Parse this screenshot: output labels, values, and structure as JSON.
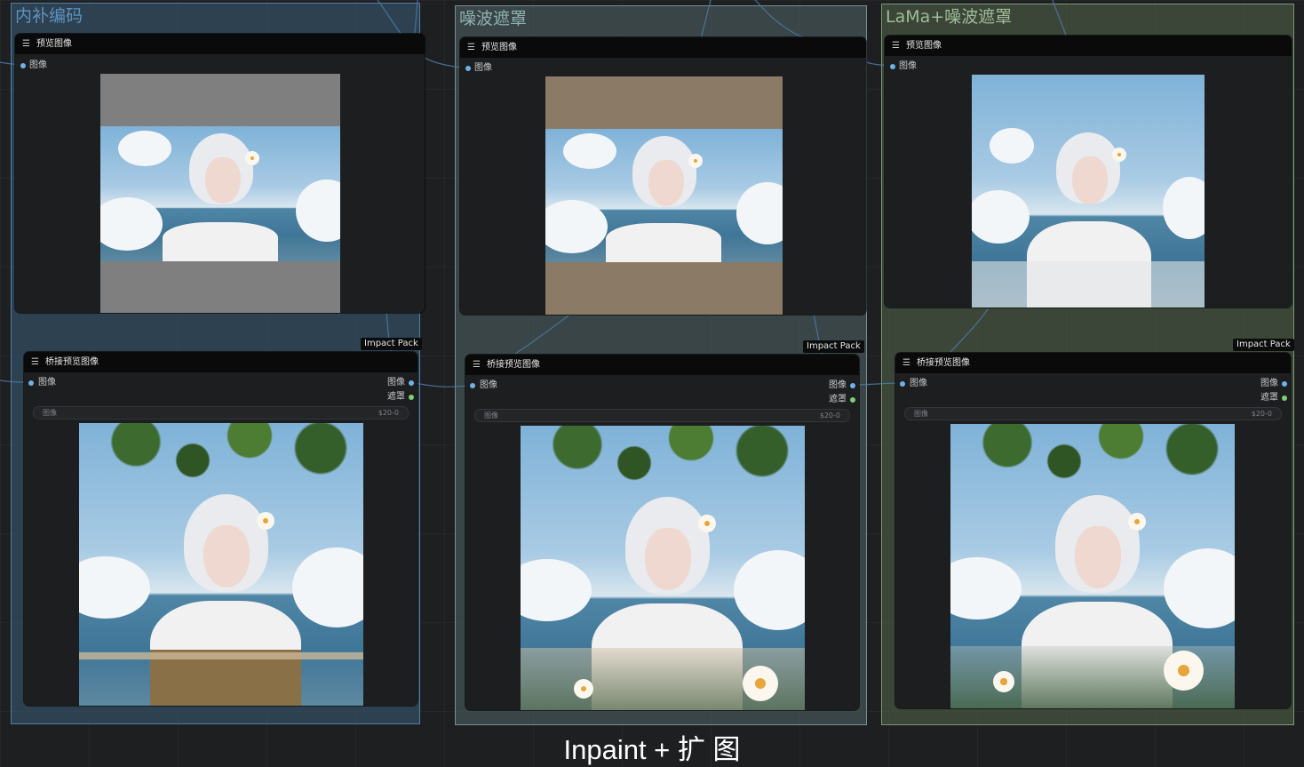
{
  "groups": [
    {
      "title": "内补编码",
      "color": "#3f6b8f"
    },
    {
      "title": "噪波遮罩",
      "color": "#6e8d8c"
    },
    {
      "title": "LaMa+噪波遮罩",
      "color": "#7d9876"
    }
  ],
  "preview_node": {
    "title": "预览图像",
    "input_label": "图像"
  },
  "bridge_node": {
    "title": "桥接预览图像",
    "input_label": "图像",
    "outputs": [
      "图像",
      "遮罩"
    ],
    "widget_label": "图像",
    "widget_value": "$20-0"
  },
  "badge": "Impact Pack",
  "caption": "Inpaint + 扩 图",
  "icons": {
    "menu": "☰"
  },
  "colors": {
    "port_image": "#6fb2ea",
    "port_mask": "#7ecf70",
    "badge_bg": "#0b0d0c"
  }
}
